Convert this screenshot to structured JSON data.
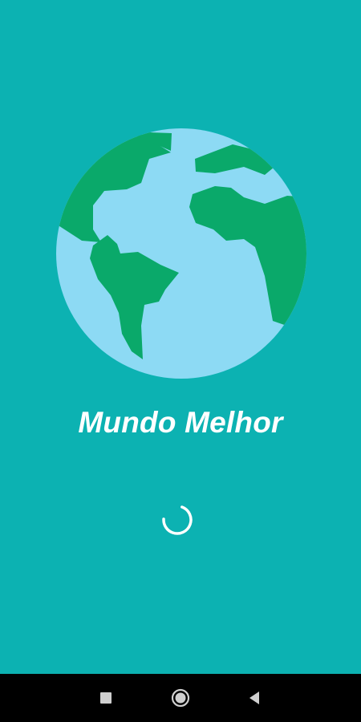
{
  "app": {
    "title": "Mundo Melhor"
  },
  "colors": {
    "background": "#0cb2b2",
    "ocean": "#8ddaf4",
    "land": "#0aa96a",
    "title": "#ffffff",
    "nav_bar": "#000000",
    "nav_icons": "#cfcfcf"
  },
  "icons": {
    "logo": "globe-icon",
    "loading": "loading-spinner",
    "nav": [
      "recents-square-icon",
      "home-circle-icon",
      "back-triangle-icon"
    ]
  }
}
